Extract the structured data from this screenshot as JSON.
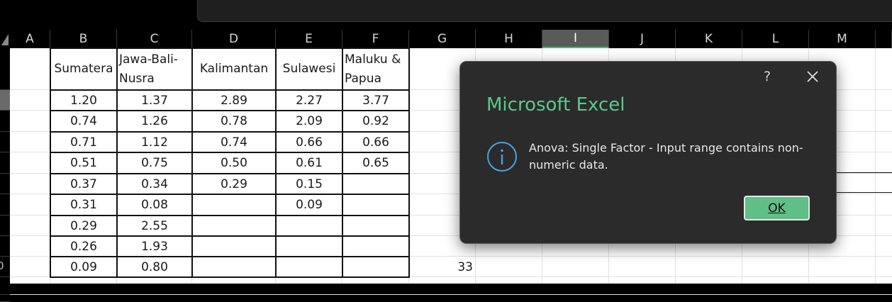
{
  "columns": [
    "A",
    "B",
    "C",
    "D",
    "E",
    "F",
    "G",
    "H",
    "I",
    "J",
    "K",
    "L",
    "M"
  ],
  "row_labels": [
    "0"
  ],
  "table": {
    "headers": [
      {
        "line1": "Sumatera",
        "line2": ""
      },
      {
        "line1": "Jawa-Bali-",
        "line2": "Nusra"
      },
      {
        "line1": "Kalimantan",
        "line2": ""
      },
      {
        "line1": "Sulawesi",
        "line2": ""
      },
      {
        "line1": "Maluku &",
        "line2": "Papua"
      }
    ],
    "rows": [
      [
        "1.20",
        "1.37",
        "2.89",
        "2.27",
        "3.77"
      ],
      [
        "0.74",
        "1.26",
        "0.78",
        "2.09",
        "0.92"
      ],
      [
        "0.71",
        "1.12",
        "0.74",
        "0.66",
        "0.66"
      ],
      [
        "0.51",
        "0.75",
        "0.50",
        "0.61",
        "0.65"
      ],
      [
        "0.37",
        "0.34",
        "0.29",
        "0.15",
        ""
      ],
      [
        "0.31",
        "0.08",
        "",
        "0.09",
        ""
      ],
      [
        "0.29",
        "2.55",
        "",
        "",
        ""
      ],
      [
        "0.26",
        "1.93",
        "",
        "",
        ""
      ],
      [
        "0.09",
        "0.80",
        "",
        "",
        ""
      ]
    ]
  },
  "g_value": "33",
  "dialog": {
    "help": "?",
    "title": "Microsoft Excel",
    "message": "Anova: Single Factor - Input range contains non-numeric data.",
    "ok_label": "OK"
  },
  "colors": {
    "accent": "#5fbf86",
    "title_green": "#5ec78a",
    "dialog_bg": "#2b2b2b",
    "info_blue": "#4aa3e0"
  }
}
